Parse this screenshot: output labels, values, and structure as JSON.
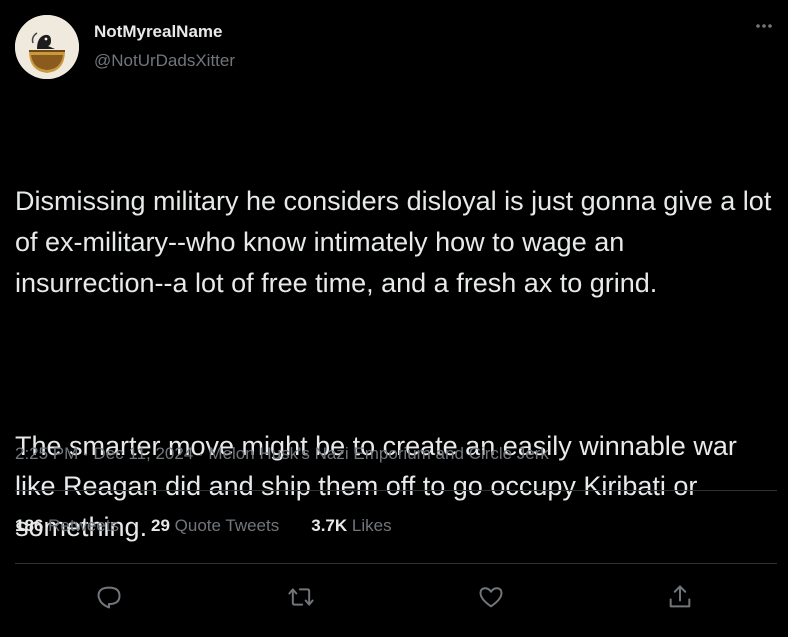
{
  "author": {
    "display_name": "NotMyrealName",
    "handle": "@NotUrDadsXitter"
  },
  "icons": {
    "more": "more-dots-icon",
    "reply": "reply-bubble-icon",
    "retweet": "retweet-icon",
    "like": "heart-icon",
    "share": "share-upload-icon"
  },
  "tweet": {
    "paragraph_1": "Dismissing military he considers disloyal is just gonna give a lot of ex-military--who know intimately how to wage an insurrection--a lot of free time, and a fresh ax to grind.",
    "paragraph_2": "The smarter move might be to create an easily winnable war like Reagan did and ship them off to go occupy Kiribati or something."
  },
  "meta": {
    "time": "2:25 PM",
    "separator": " · ",
    "date": "Dec 11, 2024",
    "source": "Melon Husk's Nazi Emporium and Circle Jerk"
  },
  "stats": {
    "retweets_count": "186",
    "retweets_label": "Retweets",
    "quotes_count": "29",
    "quotes_label": "Quote Tweets",
    "likes_count": "3.7K",
    "likes_label": "Likes"
  },
  "colors": {
    "background": "#000000",
    "primary_text": "#e7e9ea",
    "secondary_text": "#71767b",
    "divider": "#2f3336"
  }
}
